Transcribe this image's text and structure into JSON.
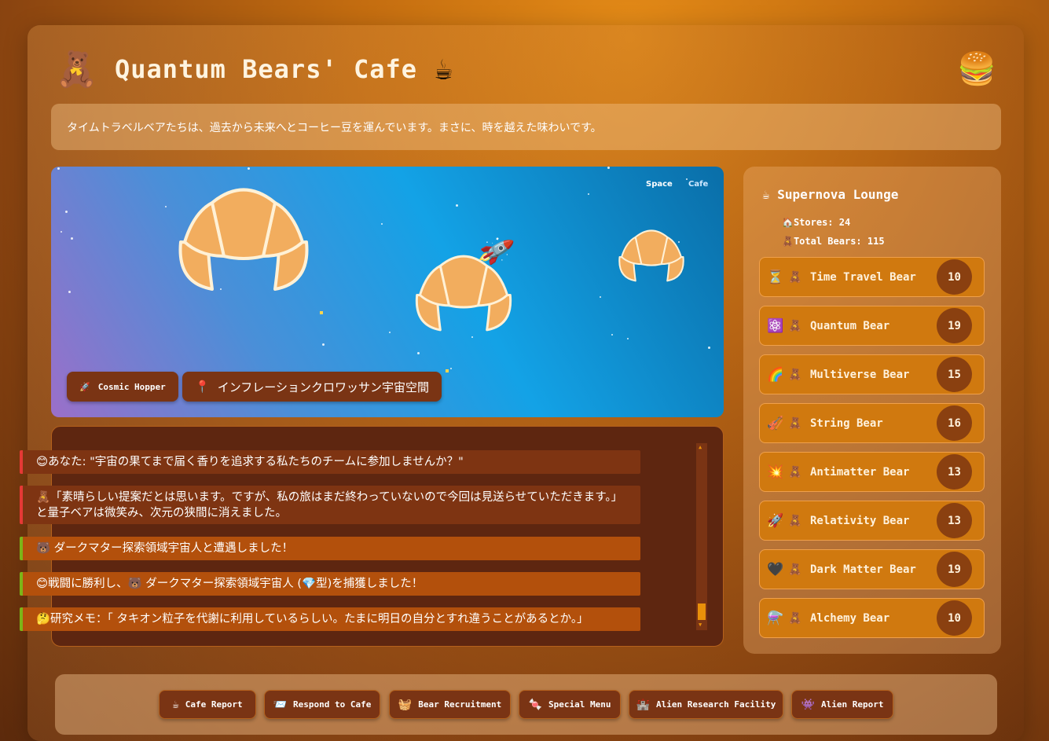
{
  "header": {
    "logo_icon": "🧸",
    "title": "Quantum Bears' Cafe",
    "title_icon": "☕",
    "menu_icon": "🍔"
  },
  "notice": "タイムトラベルベアたちは、過去から未来へとコーヒー豆を運んでいます。まさに、時を越えた味わいです。",
  "scene": {
    "tag_space": "Space",
    "tag_cafe": "Cafe",
    "rocket_icon": "🚀",
    "chip_vehicle": {
      "icon": "🚀",
      "label": "Cosmic Hopper"
    },
    "chip_location": {
      "icon": "📍",
      "label": "インフレーションクロワッサン宇宙空間"
    }
  },
  "log": [
    {
      "type": "red",
      "text": "😊あなた: \"宇宙の果てまで届く香りを追求する私たちのチームに参加しませんか？\""
    },
    {
      "type": "red",
      "text": "🧸「素晴らしい提案だとは思います。ですが、私の旅はまだ終わっていないので今回は見送らせていただきます。」と量子ベアは微笑み、次元の狭間に消えました。"
    },
    {
      "type": "green",
      "text": "🐻 ダークマター探索領域宇宙人と遭遇しました！"
    },
    {
      "type": "green",
      "text": "😊戦闘に勝利し、🐻 ダークマター探索領域宇宙人 (💎型)を捕獲しました！"
    },
    {
      "type": "green",
      "text": "🤔研究メモ：「 タキオン粒子を代謝に利用しているらしい。たまに明日の自分とすれ違うことがあるとか。」"
    }
  ],
  "sidebar": {
    "title_icon": "☕",
    "title": "Supernova Lounge",
    "stores_icon": "🏠",
    "stores": "Stores: 24",
    "bears_icon": "🧸",
    "total_bears": "Total Bears: 115",
    "bears": [
      {
        "icon": "⏳",
        "mini": "🧸",
        "name": "Time Travel Bear",
        "count": "10"
      },
      {
        "icon": "⚛️",
        "mini": "🧸",
        "name": "Quantum Bear",
        "count": "19"
      },
      {
        "icon": "🌈",
        "mini": "🧸",
        "name": "Multiverse Bear",
        "count": "15"
      },
      {
        "icon": "🎻",
        "mini": "🧸",
        "name": "String Bear",
        "count": "16"
      },
      {
        "icon": "💥",
        "mini": "🧸",
        "name": "Antimatter Bear",
        "count": "13"
      },
      {
        "icon": "🚀",
        "mini": "🧸",
        "name": "Relativity Bear",
        "count": "13"
      },
      {
        "icon": "🖤",
        "mini": "🧸",
        "name": "Dark Matter Bear",
        "count": "19"
      },
      {
        "icon": "⚗️",
        "mini": "🧸",
        "name": "Alchemy Bear",
        "count": "10"
      }
    ]
  },
  "footer": [
    {
      "icon": "☕",
      "label": "Cafe Report"
    },
    {
      "icon": "📨",
      "label": "Respond to Cafe"
    },
    {
      "icon": "🧺",
      "label": "Bear Recruitment"
    },
    {
      "icon": "🍬",
      "label": "Special Menu"
    },
    {
      "icon": "🏰",
      "label": "Alien Research Facility"
    },
    {
      "icon": "👾",
      "label": "Alien Report"
    }
  ]
}
